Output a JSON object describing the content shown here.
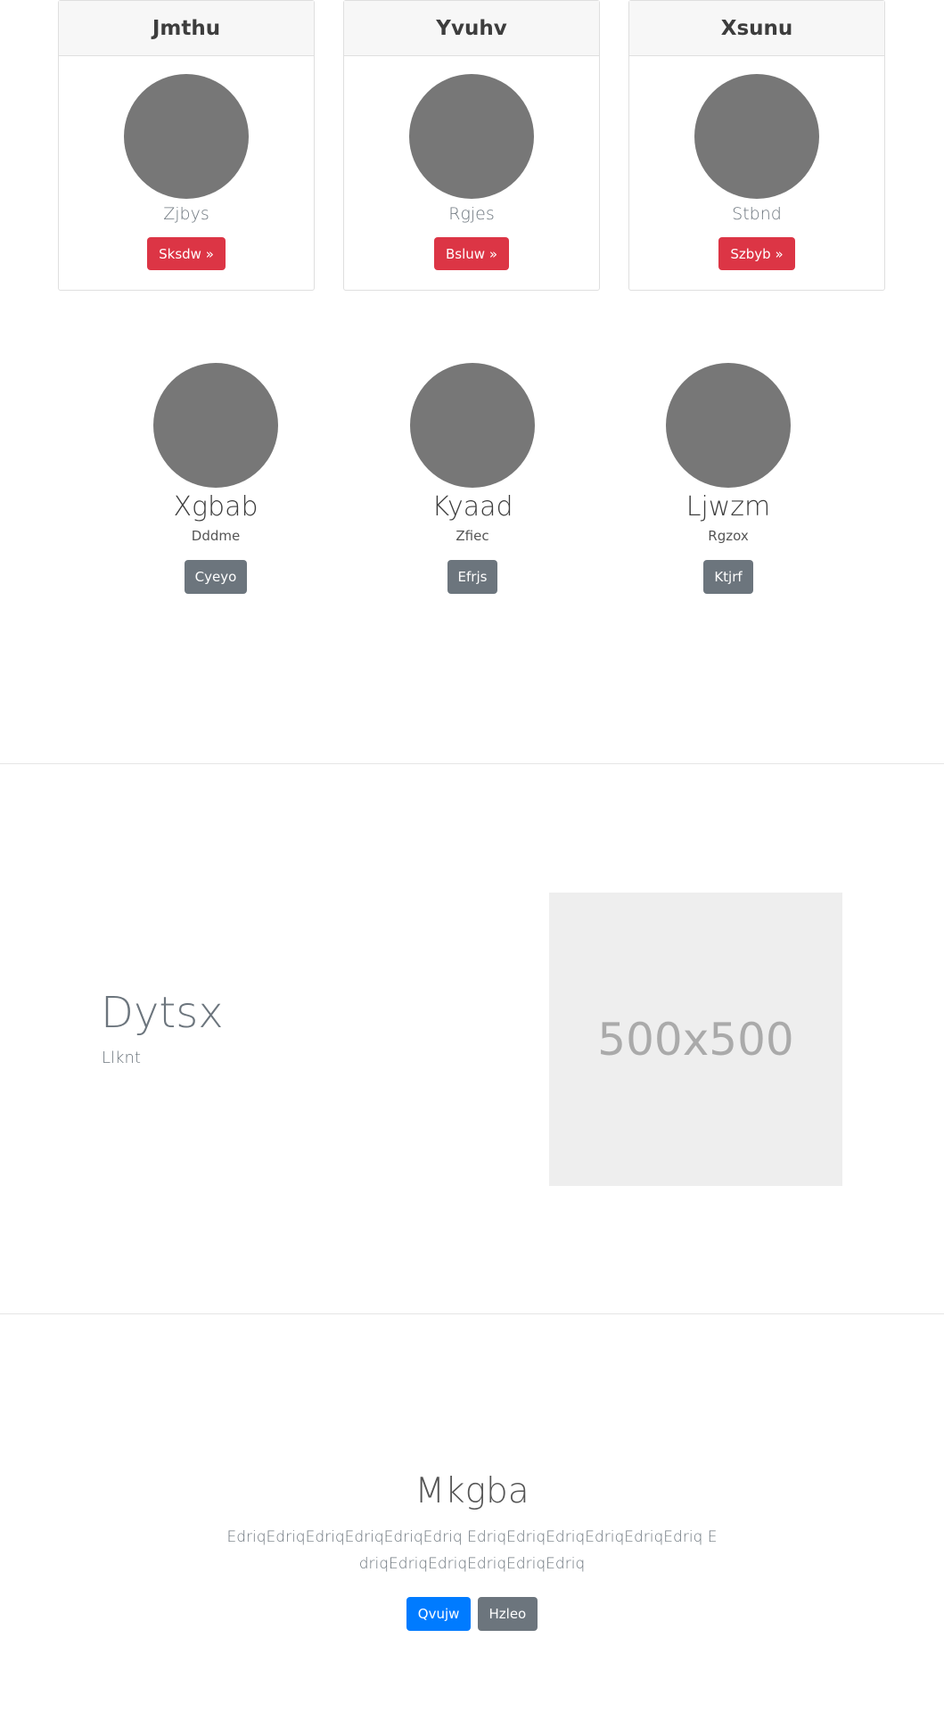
{
  "cards": [
    {
      "title": "Jmthu",
      "subtitle": "Zjbys",
      "button": "Sksdw »"
    },
    {
      "title": "Yvuhv",
      "subtitle": "Rgjes",
      "button": "Bsluw »"
    },
    {
      "title": "Xsunu",
      "subtitle": "Stbnd",
      "button": "Szbyb »"
    }
  ],
  "team": [
    {
      "name": "Xgbab",
      "role": "Dddme",
      "button": "Cyeyo"
    },
    {
      "name": "Kyaad",
      "role": "Zfiec",
      "button": "Efrjs"
    },
    {
      "name": "Ljwzm",
      "role": "Rgzox",
      "button": "Ktjrf"
    }
  ],
  "feature": {
    "title": "Dytsx",
    "subtitle": "Llknt",
    "image_label": "500x500"
  },
  "hero": {
    "title": "Mkgba",
    "text": "EdriqEdriqEdriqEdriqEdriqEdriq EdriqEdriqEdriqEdriqEdriqEdriq EdriqEdriqEdriqEdriqEdriqEdriq",
    "primary_button": "Qvujw",
    "secondary_button": "Hzleo"
  },
  "colors": {
    "danger": "#dc3545",
    "secondary": "#6c757d",
    "primary": "#007bff",
    "avatar": "#777777"
  }
}
